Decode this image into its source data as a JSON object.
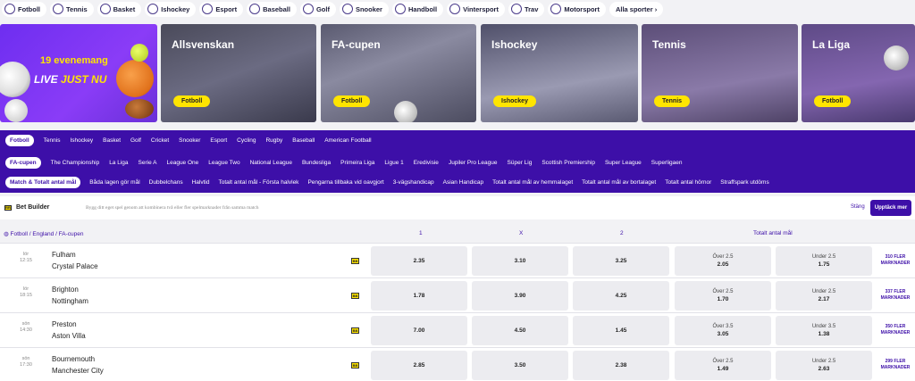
{
  "topnav": [
    {
      "label": "Fotboll",
      "icon": "football-icon"
    },
    {
      "label": "Tennis",
      "icon": "tennis-icon"
    },
    {
      "label": "Basket",
      "icon": "basketball-icon"
    },
    {
      "label": "Ishockey",
      "icon": "ice-hockey-icon"
    },
    {
      "label": "Esport",
      "icon": "esport-icon"
    },
    {
      "label": "Baseball",
      "icon": "baseball-icon"
    },
    {
      "label": "Golf",
      "icon": "golf-icon"
    },
    {
      "label": "Snooker",
      "icon": "snooker-icon"
    },
    {
      "label": "Handboll",
      "icon": "handball-icon"
    },
    {
      "label": "Vintersport",
      "icon": "wintersport-icon"
    },
    {
      "label": "Trav",
      "icon": "trotting-icon"
    },
    {
      "label": "Motorsport",
      "icon": "motorsport-icon"
    }
  ],
  "all_sports": "Alla sporter ›",
  "banners": {
    "live_count": "19 evenemang",
    "live_word": "LIVE",
    "live_now": "JUST NU",
    "items": [
      {
        "title": "Allsvenskan",
        "tag": "Fotboll"
      },
      {
        "title": "FA-cupen",
        "tag": "Fotboll"
      },
      {
        "title": "Ishockey",
        "tag": "Ishockey"
      },
      {
        "title": "Tennis",
        "tag": "Tennis"
      },
      {
        "title": "La Liga",
        "tag": "Fotboll"
      }
    ]
  },
  "filters": {
    "sports": [
      "Fotboll",
      "Tennis",
      "Ishockey",
      "Basket",
      "Golf",
      "Cricket",
      "Snooker",
      "Esport",
      "Cycling",
      "Rugby",
      "Baseball",
      "American Football"
    ],
    "leagues": [
      "FA-cupen",
      "The Championship",
      "La Liga",
      "Serie A",
      "League One",
      "League Two",
      "National League",
      "Bundesliga",
      "Primeira Liga",
      "Ligue 1",
      "Eredivisie",
      "Jupiler Pro League",
      "Süper Lig",
      "Scottish Premiership",
      "Super League",
      "Superligaen"
    ],
    "markets": [
      "Match & Totalt antal mål",
      "Båda lagen gör mål",
      "Dubbelchans",
      "Halvtid",
      "Totalt antal mål - Första halvlek",
      "Pengarna tillbaka vid oavgjort",
      "3-vägshandicap",
      "Asian Handicap",
      "Totalt antal mål av hemmalaget",
      "Totalt antal mål av bortalaget",
      "Totalt antal hörnor",
      "Straffspark utdöms"
    ]
  },
  "bet_builder": {
    "logo": "BB",
    "title": "Bet Builder",
    "description": "Bygg ditt eget spel genom att kombinera två eller fler spelmarknader från samma match",
    "close": "Stäng",
    "discover": "Upptäck mer"
  },
  "table": {
    "breadcrumb": "Fotboll / England / FA-cupen",
    "col_1": "1",
    "col_x": "X",
    "col_2": "2",
    "col_total": "Totalt antal mål",
    "rows": [
      {
        "day": "lör",
        "time": "12:15",
        "home": "Fulham",
        "away": "Crystal Palace",
        "o1": "2.35",
        "ox": "3.10",
        "o2": "3.25",
        "over_label": "Över 2.5",
        "over": "2.05",
        "under_label": "Under 2.5",
        "under": "1.75",
        "more": "310 FLER MARKNADER"
      },
      {
        "day": "lör",
        "time": "18:15",
        "home": "Brighton",
        "away": "Nottingham",
        "o1": "1.78",
        "ox": "3.90",
        "o2": "4.25",
        "over_label": "Över 2.5",
        "over": "1.70",
        "under_label": "Under 2.5",
        "under": "2.17",
        "more": "337 FLER MARKNADER"
      },
      {
        "day": "sön",
        "time": "14:30",
        "home": "Preston",
        "away": "Aston Villa",
        "o1": "7.00",
        "ox": "4.50",
        "o2": "1.45",
        "over_label": "Över 3.5",
        "over": "3.05",
        "under_label": "Under 3.5",
        "under": "1.38",
        "more": "350 FLER MARKNADER"
      },
      {
        "day": "sön",
        "time": "17:30",
        "home": "Bournemouth",
        "away": "Manchester City",
        "o1": "2.85",
        "ox": "3.50",
        "o2": "2.38",
        "over_label": "Över 2.5",
        "over": "1.49",
        "under_label": "Under 2.5",
        "under": "2.63",
        "more": "299 FLER MARKNADER"
      }
    ]
  },
  "colors": {
    "brand_purple": "#3d0fa8",
    "accent_yellow": "#ffe500"
  }
}
